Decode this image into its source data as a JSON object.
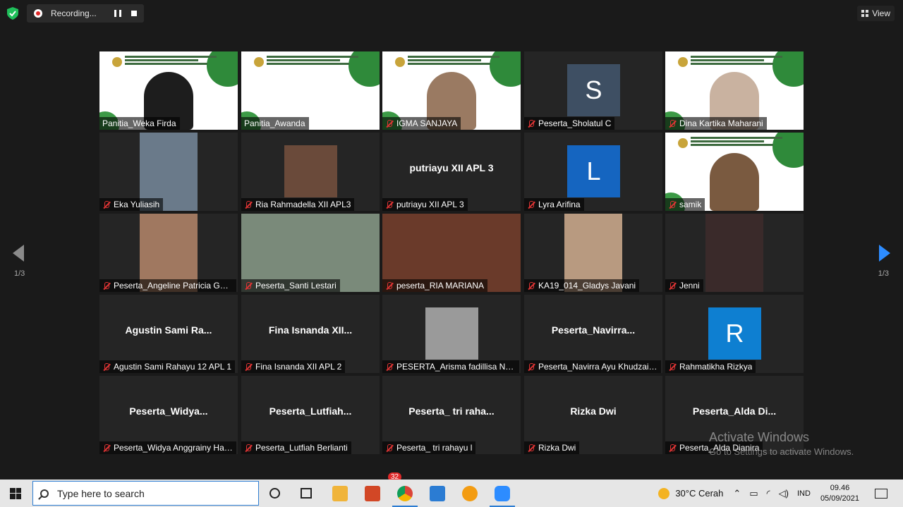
{
  "recording": {
    "label": "Recording..."
  },
  "view_button": {
    "label": "View"
  },
  "pagination": {
    "left": "1/3",
    "right": "1/3"
  },
  "tiles": [
    {
      "name": "Panitia_Weka Firda",
      "muted": false,
      "big": ""
    },
    {
      "name": "Panitia_Awanda",
      "muted": false,
      "big": "",
      "active": true
    },
    {
      "name": "IGMA SANJAYA",
      "muted": true,
      "big": ""
    },
    {
      "name": "Peserta_Sholatul C",
      "muted": true,
      "big": "",
      "avatar_letter": "S",
      "avatar_color": "#3e4f63"
    },
    {
      "name": "Dina Kartika Maharani",
      "muted": true,
      "big": ""
    },
    {
      "name": "Eka Yuliasih",
      "muted": true,
      "big": ""
    },
    {
      "name": "Ria Rahmadella XII APL3",
      "muted": true,
      "big": ""
    },
    {
      "name": "putriayu XII APL 3",
      "muted": true,
      "big": "putriayu XII APL 3"
    },
    {
      "name": "Lyra Arifina",
      "muted": true,
      "big": "",
      "avatar_letter": "L",
      "avatar_color": "#1565c0"
    },
    {
      "name": "samik",
      "muted": true,
      "big": ""
    },
    {
      "name": "Peserta_Angeline Patricia Gab...",
      "muted": true,
      "big": ""
    },
    {
      "name": "Peserta_Santi Lestari",
      "muted": true,
      "big": ""
    },
    {
      "name": "peserta_RIA MARIANA",
      "muted": true,
      "big": ""
    },
    {
      "name": "KA19_014_Gladys Javani",
      "muted": true,
      "big": ""
    },
    {
      "name": "Jenni",
      "muted": true,
      "big": ""
    },
    {
      "name": "Agustin Sami Rahayu 12 APL 1",
      "muted": true,
      "big": "Agustin Sami Ra..."
    },
    {
      "name": "Fina Isnanda XII APL 2",
      "muted": true,
      "big": "Fina Isnanda XII..."
    },
    {
      "name": "PESERTA_Arisma fadillisa Nur ...",
      "muted": true,
      "big": ""
    },
    {
      "name": "Peserta_Navirra Ayu Khudzaif...",
      "muted": true,
      "big": "Peserta_Navirra..."
    },
    {
      "name": "Rahmatikha Rizkya",
      "muted": true,
      "big": "",
      "avatar_letter": "R",
      "avatar_color": "#0e7fd1"
    },
    {
      "name": "Peserta_Widya Anggrainy Har...",
      "muted": true,
      "big": "Peserta_Widya..."
    },
    {
      "name": "Peserta_Lutfiah Berlianti",
      "muted": true,
      "big": "Peserta_Lutfiah..."
    },
    {
      "name": "Peserta_ tri rahayu l",
      "muted": true,
      "big": "Peserta_ tri raha..."
    },
    {
      "name": "Rizka Dwi",
      "muted": true,
      "big": "Rizka Dwi"
    },
    {
      "name": "Peserta_Alda Dianira",
      "muted": true,
      "big": "Peserta_Alda Di..."
    }
  ],
  "watermark": {
    "line1": "Activate Windows",
    "line2": "Go to Settings to activate Windows."
  },
  "toolbar": {
    "chat_badge": "32"
  },
  "taskbar": {
    "search_placeholder": "Type here to search",
    "weather": "30°C Cerah",
    "language": "IND",
    "time": "09.46",
    "date": "05/09/2021"
  },
  "colors": {
    "active_outline": "#e2f25a",
    "zoom_blue": "#2d8cff",
    "muted_red": "#e03434"
  }
}
